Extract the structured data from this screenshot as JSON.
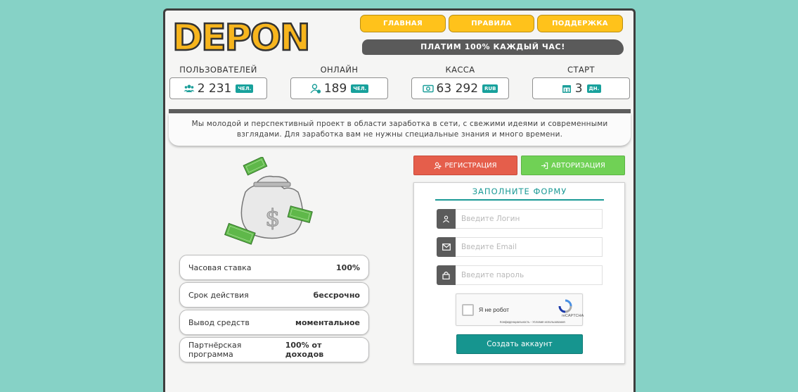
{
  "logo": {
    "text": "DEPON"
  },
  "nav": {
    "items": [
      "ГЛАВНАЯ",
      "ПРАВИЛА",
      "ПОДДЕРЖКА"
    ]
  },
  "banner": {
    "text": "ПЛАТИМ 100% КАЖДЫЙ ЧАС!"
  },
  "stats": [
    {
      "title": "ПОЛЬЗОВАТЕЛЕЙ",
      "value": "2 231",
      "unit": "ЧЕЛ.",
      "icon": "users-icon"
    },
    {
      "title": "ОНЛАЙН",
      "value": "189",
      "unit": "ЧЕЛ.",
      "icon": "user-online-icon"
    },
    {
      "title": "КАССА",
      "value": "63 292",
      "unit": "RUB",
      "icon": "money-icon"
    },
    {
      "title": "СТАРТ",
      "value": "3",
      "unit": "ДН.",
      "icon": "calendar-icon"
    }
  ],
  "description": "Мы молодой и перспективный проект в области заработка в сети, с свежими идеями и современными взглядами. Для заработка вам не нужны специальные знания и много времени.",
  "info": [
    {
      "label": "Часовая ставка",
      "value": "100%"
    },
    {
      "label": "Срок действия",
      "value": "бессрочно"
    },
    {
      "label": "Вывод средств",
      "value": "моментальное"
    },
    {
      "label": "Партнёрская программа",
      "value": "100% от доходов"
    }
  ],
  "auth": {
    "register_label": "РЕГИСТРАЦИЯ",
    "login_label": "АВТОРИЗАЦИЯ"
  },
  "form": {
    "title": "ЗАПОЛНИТЕ ФОРМУ",
    "login_placeholder": "Введите Логин",
    "email_placeholder": "Введите Email",
    "password_placeholder": "Введите пароль",
    "captcha_label": "Я не робот",
    "captcha_brand": "reCAPTCHA",
    "captcha_links": "Конфиденциальность - Условия использования",
    "submit_label": "Создать аккаунт"
  },
  "colors": {
    "background": "#86d2c6",
    "accent": "#ffc21b",
    "teal": "#16958f",
    "register": "#e55e4b",
    "login": "#70d155"
  }
}
